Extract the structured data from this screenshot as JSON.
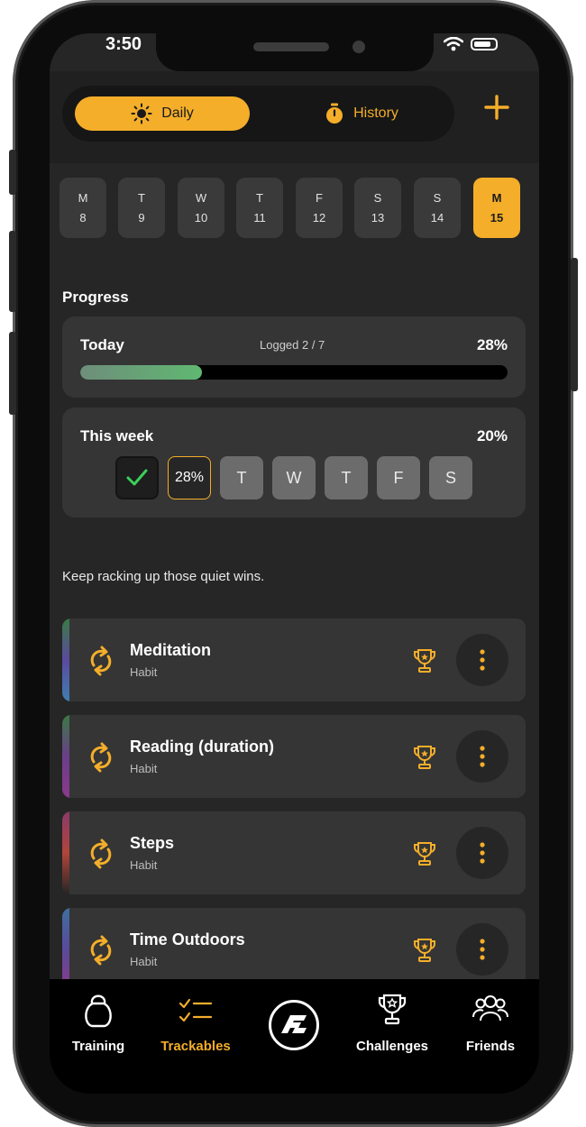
{
  "status": {
    "time": "3:50"
  },
  "header": {
    "daily_label": "Daily",
    "history_label": "History"
  },
  "days": [
    {
      "letter": "M",
      "num": "8"
    },
    {
      "letter": "T",
      "num": "9"
    },
    {
      "letter": "W",
      "num": "10"
    },
    {
      "letter": "T",
      "num": "11"
    },
    {
      "letter": "F",
      "num": "12"
    },
    {
      "letter": "S",
      "num": "13"
    },
    {
      "letter": "S",
      "num": "14"
    },
    {
      "letter": "M",
      "num": "15"
    }
  ],
  "progress": {
    "title": "Progress",
    "today_label": "Today",
    "logged": "Logged 2 / 7",
    "today_pct": "28%",
    "today_fraction": 0.285,
    "week_label": "This week",
    "week_pct": "20%",
    "week_days": [
      "",
      "28%",
      "T",
      "W",
      "T",
      "F",
      "S"
    ]
  },
  "motto": "Keep racking up those quiet wins.",
  "habits": [
    {
      "name": "Meditation",
      "type": "Habit"
    },
    {
      "name": "Reading (duration)",
      "type": "Habit"
    },
    {
      "name": "Steps",
      "type": "Habit"
    },
    {
      "name": "Time Outdoors",
      "type": "Habit"
    }
  ],
  "nav": {
    "training": "Training",
    "trackables": "Trackables",
    "challenges": "Challenges",
    "friends": "Friends"
  },
  "colors": {
    "accent": "#f4ae2a",
    "background": "#262626",
    "card": "#353535",
    "progress_fill": "#5fb872",
    "check": "#3ccf5a"
  }
}
